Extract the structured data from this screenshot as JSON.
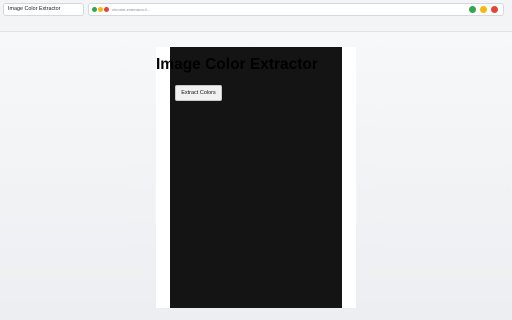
{
  "browser": {
    "tab_title": "Image Color Extractor",
    "url": "chrome-extension://...",
    "traffic_lights": {
      "colors": [
        "#2fa84f",
        "#f5b80f",
        "#e54335"
      ]
    },
    "window_controls": {
      "colors": [
        "#2fa84f",
        "#f5b80f",
        "#e54335"
      ]
    }
  },
  "page": {
    "heading": "Image Color Extractor",
    "extract_button_label": "Extract Colors",
    "panel_color": "#141414"
  }
}
